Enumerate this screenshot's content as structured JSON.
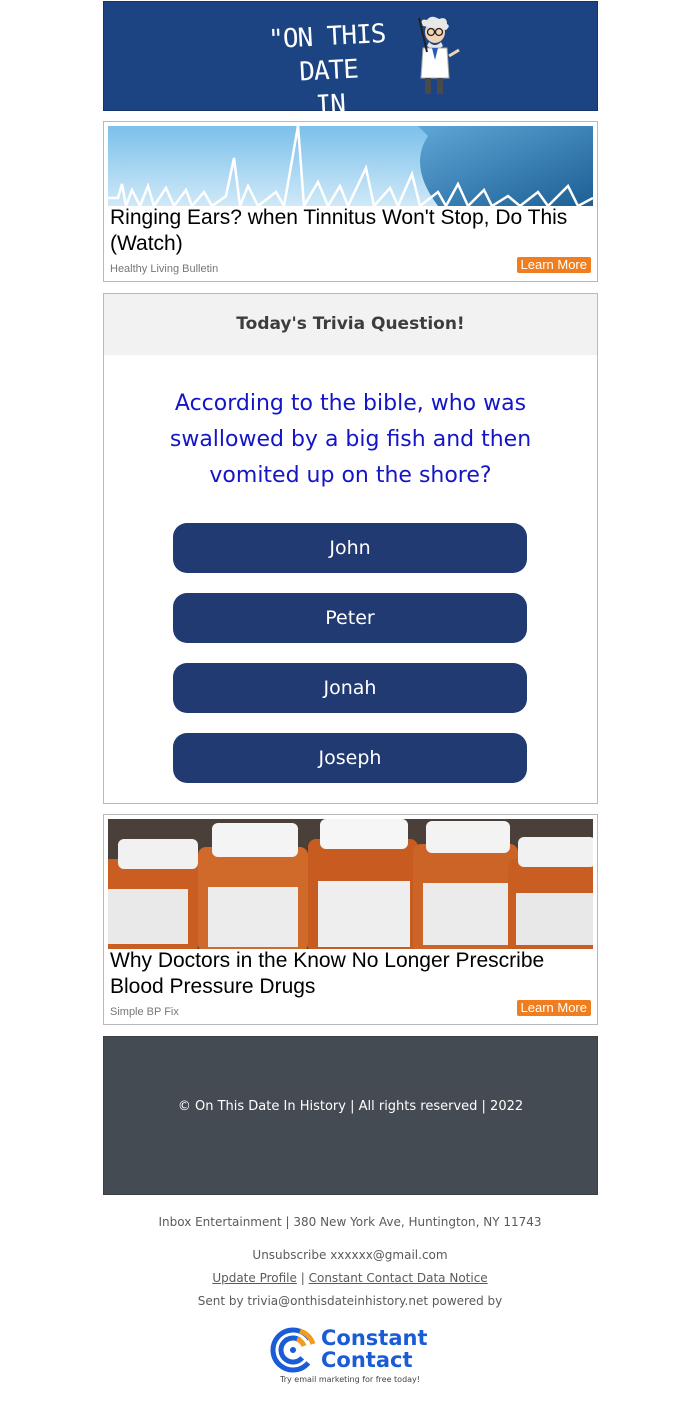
{
  "header": {
    "title_line1": "\"ON THIS DATE",
    "title_line2": "IN HISTORY...\""
  },
  "ads": [
    {
      "title": "Ringing Ears? when Tinnitus Won't Stop, Do This (Watch)",
      "source": "Healthy Living Bulletin",
      "cta": "Learn More"
    },
    {
      "title": "Why Doctors in the Know No Longer Prescribe Blood Pressure Drugs",
      "source": "Simple BP Fix",
      "cta": "Learn More"
    }
  ],
  "trivia": {
    "heading": "Today's Trivia Question!",
    "question": "According to the bible, who was swallowed by a big fish and then vomited up on the shore?",
    "answers": [
      "John",
      "Peter",
      "Jonah",
      "Joseph"
    ]
  },
  "footer": {
    "copyright": "© On This Date In History | All rights reserved | 2022",
    "address": "Inbox Entertainment | 380 New York Ave, Huntington, NY 11743",
    "unsubscribe": "Unsubscribe xxxxxx@gmail.com",
    "update_profile": "Update Profile",
    "separator": "|",
    "data_notice": "Constant Contact Data Notice",
    "sent_by": "Sent by trivia@onthisdateinhistory.net powered by",
    "cc_name_line1": "Constant",
    "cc_name_line2": "Contact",
    "cc_tagline": "Try email marketing for free today!"
  },
  "colors": {
    "header_bg": "#1c4483",
    "answer_bg": "#213a72",
    "question_text": "#1515c8",
    "cta_bg": "#f07d1e",
    "footer_bg": "#454b53",
    "cc_brand": "#1a5bd6"
  }
}
